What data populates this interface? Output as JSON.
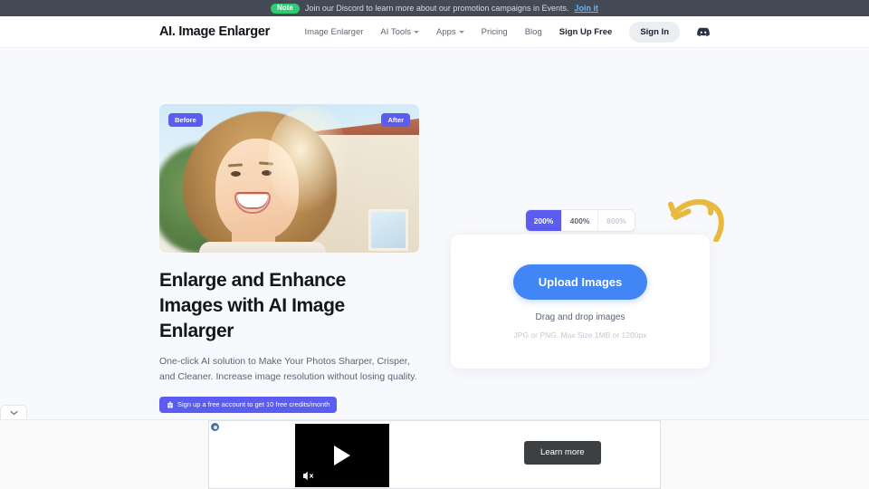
{
  "notice": {
    "tag": "Note",
    "text": "Join our Discord to learn more about our promotion campaigns in Events.",
    "link": "Join it"
  },
  "header": {
    "logo": "AI. Image Enlarger",
    "nav": [
      {
        "label": "Image Enlarger",
        "has_caret": false
      },
      {
        "label": "AI Tools",
        "has_caret": true
      },
      {
        "label": "Apps",
        "has_caret": true
      },
      {
        "label": "Pricing",
        "has_caret": false
      },
      {
        "label": "Blog",
        "has_caret": false
      }
    ],
    "signup_label": "Sign Up Free",
    "signin_label": "Sign In",
    "discord_icon": "discord-icon"
  },
  "hero": {
    "badge_before": "Before",
    "badge_after": "After",
    "headline": "Enlarge and Enhance Images with AI Image Enlarger",
    "subhead": "One-click AI solution to Make Your Photos Sharper, Crisper, and Cleaner. Increase image resolution without losing quality.",
    "credits_badge": "Sign up a free account to get 10 free credits/month",
    "credits_icon": "gift-icon"
  },
  "uploader": {
    "scales": [
      {
        "label": "200%",
        "state": "active"
      },
      {
        "label": "400%",
        "state": "default"
      },
      {
        "label": "800%",
        "state": "disabled"
      }
    ],
    "button_label": "Upload Images",
    "drag_text": "Drag and drop images",
    "hint_text": "JPG or PNG. Max Size 1MB or 1200px",
    "arrow_icon": "curved-arrow-icon",
    "arrow_color": "#e8b93f"
  },
  "ad": {
    "tab_icon": "chevron-down-icon",
    "info_icon": "ad-info-icon",
    "play_icon": "play-icon",
    "mute_icon": "muted-speaker-icon",
    "learn_more_label": "Learn more"
  },
  "colors": {
    "accent_purple": "#5b5cf0",
    "accent_blue": "#4285f4",
    "notice_bg": "#434a56",
    "note_green": "#2ecc71",
    "page_bg": "#f8f9fc"
  }
}
